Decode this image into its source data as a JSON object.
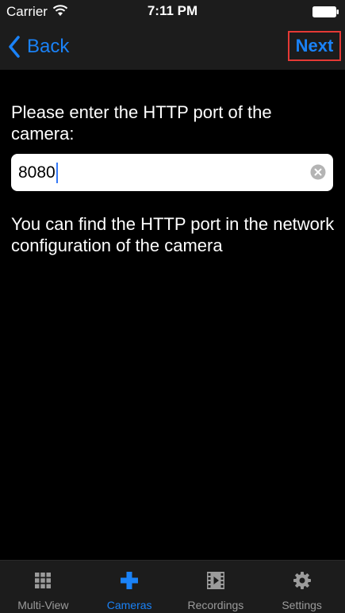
{
  "status_bar": {
    "carrier": "Carrier",
    "time": "7:11 PM"
  },
  "nav": {
    "back_label": "Back",
    "next_label": "Next"
  },
  "form": {
    "prompt": "Please enter the HTTP port of the camera:",
    "port_value": "8080",
    "help": "You can find the HTTP port in the network configuration of the camera"
  },
  "tabs": [
    {
      "label": "Multi-View",
      "icon": "grid-icon",
      "active": false
    },
    {
      "label": "Cameras",
      "icon": "plus-icon",
      "active": true
    },
    {
      "label": "Recordings",
      "icon": "film-icon",
      "active": false
    },
    {
      "label": "Settings",
      "icon": "gear-icon",
      "active": false
    }
  ],
  "colors": {
    "accent": "#1a82f7",
    "highlight_border": "#e53935",
    "background": "#000000",
    "bar_background": "#1c1c1c",
    "inactive_tab": "#9b9b9b"
  }
}
